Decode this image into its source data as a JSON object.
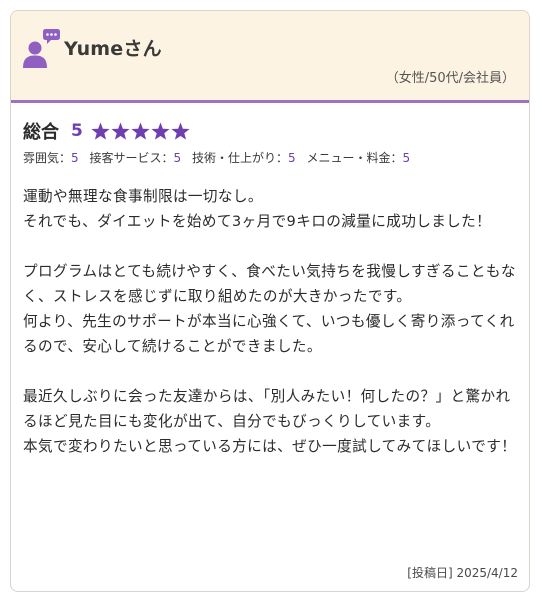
{
  "reviewer": {
    "name": "Yumeさん",
    "meta": "（女性/50代/会社員）",
    "avatar_icon": "user-comment-icon",
    "accent_color": "#9b72c4"
  },
  "rating": {
    "overall_label": "総合",
    "overall_score": "5",
    "stars": 5,
    "stars_max": 5,
    "star_color": "#6f3fb0",
    "sub": [
      {
        "label": "雰囲気：",
        "value": "5"
      },
      {
        "label": "接客サービス：",
        "value": "5"
      },
      {
        "label": "技術・仕上がり：",
        "value": "5"
      },
      {
        "label": "メニュー・料金：",
        "value": "5"
      }
    ]
  },
  "review": {
    "body": "運動や無理な食事制限は一切なし。\nそれでも、ダイエットを始めて3ヶ月で9キロの減量に成功しました！\n\nプログラムはとても続けやすく、食べたい気持ちを我慢しすぎることもなく、ストレスを感じずに取り組めたのが大きかったです。\n何より、先生のサポートが本当に心強くて、いつも優しく寄り添ってくれるので、安心して続けることができました。\n\n最近久しぶりに会った友達からは、「別人みたい！何したの？」と驚かれるほど見た目にも変化が出て、自分でもびっくりしています。\n本気で変わりたいと思っている方には、ぜひ一度試してみてほしいです！",
    "post_date": "[投稿日] 2025/4/12"
  }
}
